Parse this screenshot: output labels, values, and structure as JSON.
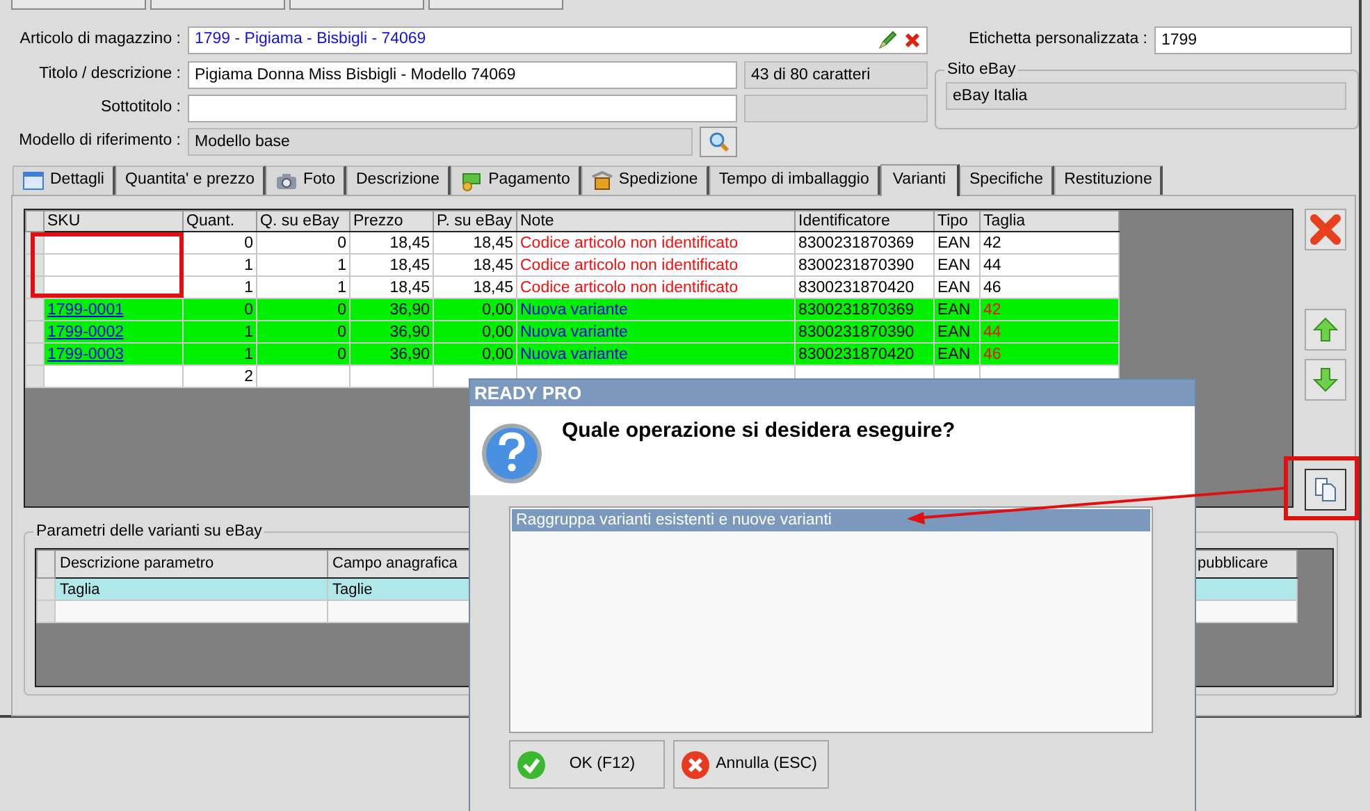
{
  "form": {
    "article": {
      "label": "Articolo di magazzino :",
      "value": "1799 - Pigiama - Bisbigli - 74069"
    },
    "custom_label": {
      "label": "Etichetta personalizzata :",
      "value": "1799"
    },
    "title": {
      "label": "Titolo / descrizione :",
      "value": "Pigiama Donna Miss Bisbigli - Modello 74069",
      "counter": "43 di 80 caratteri"
    },
    "subtitle": {
      "label": "Sottotitolo :"
    },
    "reference_model": {
      "label": "Modello di riferimento :",
      "value": "Modello base"
    },
    "ebay_site": {
      "legend": "Sito eBay",
      "value": "eBay Italia"
    }
  },
  "tabs": [
    {
      "label": "Dettagli",
      "selected": false
    },
    {
      "label": "Quantita' e prezzo",
      "selected": false
    },
    {
      "label": "Foto",
      "selected": false
    },
    {
      "label": "Descrizione",
      "selected": false
    },
    {
      "label": "Pagamento",
      "selected": false
    },
    {
      "label": "Spedizione",
      "selected": false
    },
    {
      "label": "Tempo di imballaggio",
      "selected": false
    },
    {
      "label": "Varianti",
      "selected": true
    },
    {
      "label": "Specifiche",
      "selected": false
    },
    {
      "label": "Restituzione",
      "selected": false
    }
  ],
  "variants_table": {
    "columns": [
      "SKU",
      "Quant.",
      "Q. su eBay",
      "Prezzo",
      "P. su eBay",
      "Note",
      "Identificatore",
      "Tipo",
      "Taglia"
    ],
    "rows": [
      {
        "kind": "existing",
        "cells": [
          "",
          "0",
          "0",
          "18,45",
          "18,45",
          "Codice articolo non identificato",
          "8300231870369",
          "EAN",
          "42"
        ]
      },
      {
        "kind": "existing",
        "cells": [
          "",
          "1",
          "1",
          "18,45",
          "18,45",
          "Codice articolo non identificato",
          "8300231870390",
          "EAN",
          "44"
        ]
      },
      {
        "kind": "existing",
        "cells": [
          "",
          "1",
          "1",
          "18,45",
          "18,45",
          "Codice articolo non identificato",
          "8300231870420",
          "EAN",
          "46"
        ]
      },
      {
        "kind": "new",
        "cells": [
          "1799-0001",
          "0",
          "0",
          "36,90",
          "0,00",
          "Nuova variante",
          "8300231870369",
          "EAN",
          "42"
        ]
      },
      {
        "kind": "new",
        "cells": [
          "1799-0002",
          "1",
          "0",
          "36,90",
          "0,00",
          "Nuova variante",
          "8300231870390",
          "EAN",
          "44"
        ]
      },
      {
        "kind": "new",
        "cells": [
          "1799-0003",
          "1",
          "0",
          "36,90",
          "0,00",
          "Nuova variante",
          "8300231870420",
          "EAN",
          "46"
        ]
      },
      {
        "kind": "total",
        "cells": [
          "",
          "2",
          "",
          "",
          "",
          "",
          "",
          "",
          ""
        ]
      }
    ]
  },
  "parameters": {
    "legend": "Parametri delle varianti su eBay",
    "columns": [
      "Descrizione parametro",
      "Campo anagrafica",
      "pubblicare"
    ],
    "rows": [
      {
        "cells": [
          "Taglia",
          "Taglie"
        ],
        "selected": true
      }
    ]
  },
  "dialog": {
    "title": "READY PRO",
    "question": "Quale operazione si desidera eseguire?",
    "options": [
      {
        "label": "Raggruppa varianti esistenti e nuove varianti",
        "selected": true
      }
    ],
    "buttons": [
      {
        "kind": "ok",
        "label": "OK (F12)"
      },
      {
        "kind": "cancel",
        "label": "Annulla (ESC)"
      }
    ]
  }
}
